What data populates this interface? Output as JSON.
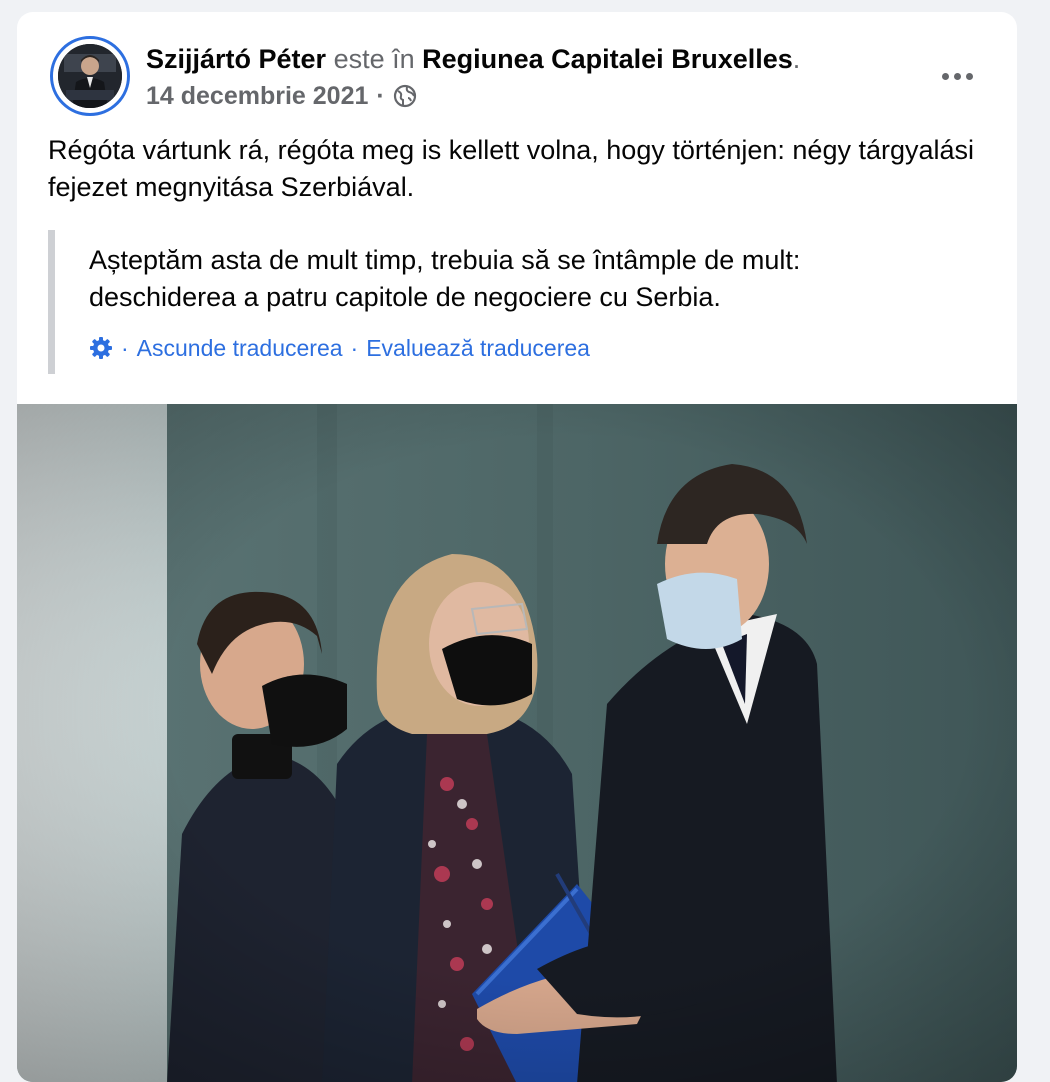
{
  "post": {
    "author": "Szijjártó Péter",
    "connector": " este în ",
    "location": "Regiunea Capitalei Bruxelles",
    "location_suffix": ".",
    "date": "14 decembrie 2021",
    "dot": "·",
    "privacy_icon": "globe-icon",
    "more_icon": "more-dots-icon",
    "text": "Régóta vártunk rá, régóta meg is kellett volna, hogy történjen: négy tárgyalási fejezet megnyitása Szerbiával."
  },
  "translation": {
    "text_line1": "Așteptăm asta de mult timp, trebuia să se întâmple de mult:",
    "text_line2": "deschiderea a patru capitole de negociere cu Serbia.",
    "settings_icon": "gear-icon",
    "sep": "·",
    "hide_label": "Ascunde traducerea",
    "rate_label": "Evaluează traducerea"
  },
  "colors": {
    "accent": "#2d6fe0",
    "background": "#f0f2f5",
    "text_primary": "#050505",
    "text_secondary": "#65676b"
  }
}
